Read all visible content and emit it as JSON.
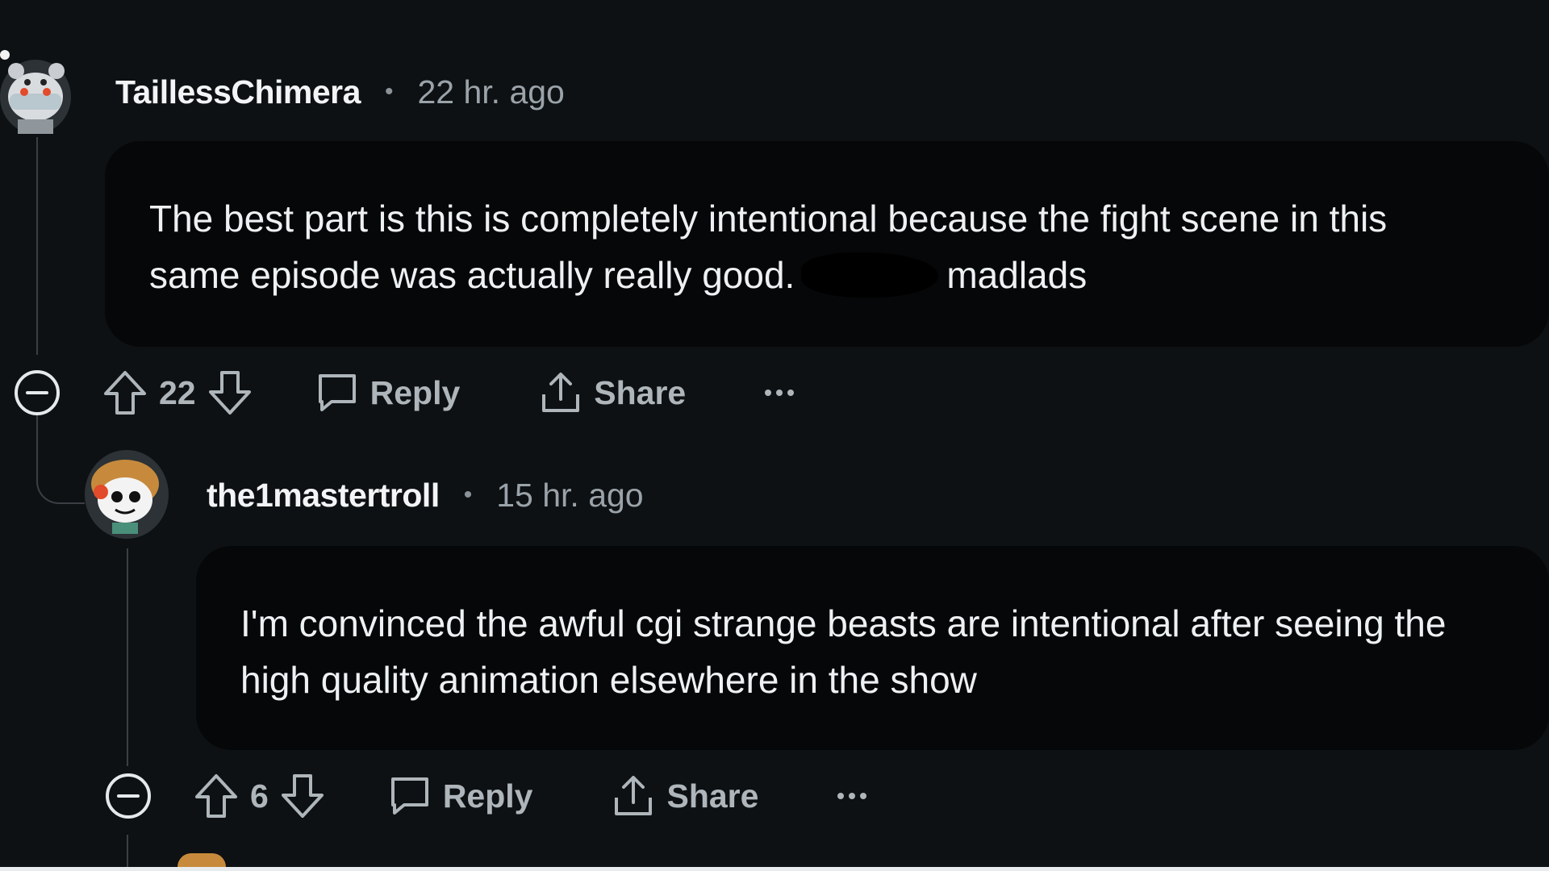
{
  "comments": [
    {
      "username": "TaillessChimera",
      "separator": "•",
      "time": "22 hr. ago",
      "text_line1": "The best part is this is completely intentional because the fight scene in this",
      "text_line2_before": "same episode was actually really good.",
      "text_line2_after": "madlads",
      "score": "22",
      "reply_label": "Reply",
      "share_label": "Share",
      "more_label": "···"
    },
    {
      "username": "the1mastertroll",
      "separator": "•",
      "time": "15 hr. ago",
      "text_line1": "I'm convinced the awful cgi strange beasts are intentional after seeing the",
      "text_line2": "high quality animation elsewhere in the show",
      "score": "6",
      "reply_label": "Reply",
      "share_label": "Share",
      "more_label": "···"
    }
  ],
  "colors": {
    "background": "#0e1113",
    "bubble": "#050708",
    "text": "#eef1f3",
    "muted": "#aeb6bb"
  }
}
